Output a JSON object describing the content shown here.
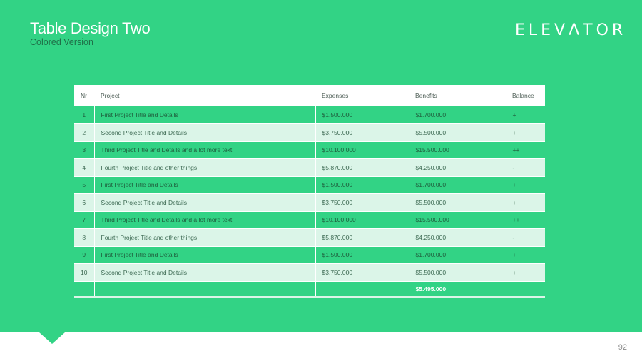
{
  "slide": {
    "title": "Table Design Two",
    "subtitle": "Colored Version",
    "logo_text": "ELEVΛTOR",
    "page_number": "92"
  },
  "colors": {
    "background": "#32d385",
    "row_light": "#dbf5e8",
    "header_bg": "#ffffff"
  },
  "table": {
    "headers": [
      "Nr",
      "Project",
      "Expenses",
      "Benefits",
      "Balance"
    ],
    "rows": [
      [
        "1",
        "First Project Title and Details",
        "$1.500.000",
        "$1.700.000",
        "+"
      ],
      [
        "2",
        "Second Project Title and Details",
        "$3.750.000",
        "$5.500.000",
        "+"
      ],
      [
        "3",
        "Third Project Title and Details and a lot more text",
        "$10.100.000",
        "$15.500.000",
        "++"
      ],
      [
        "4",
        "Fourth Project Title and other things",
        "$5.870.000",
        "$4.250.000",
        "-"
      ],
      [
        "5",
        "First Project Title and Details",
        "$1.500.000",
        "$1.700.000",
        "+"
      ],
      [
        "6",
        "Second Project Title and Details",
        "$3.750.000",
        "$5.500.000",
        "+"
      ],
      [
        "7",
        "Third Project Title and Details and a lot more text",
        "$10.100.000",
        "$15.500.000",
        "++"
      ],
      [
        "8",
        "Fourth Project Title and other things",
        "$5.870.000",
        "$4.250.000",
        "-"
      ],
      [
        "9",
        "First Project Title and Details",
        "$1.500.000",
        "$1.700.000",
        "+"
      ],
      [
        "10",
        "Second Project Title and Details",
        "$3.750.000",
        "$5.500.000",
        "+"
      ]
    ],
    "total_benefits": "$5.495.000"
  }
}
